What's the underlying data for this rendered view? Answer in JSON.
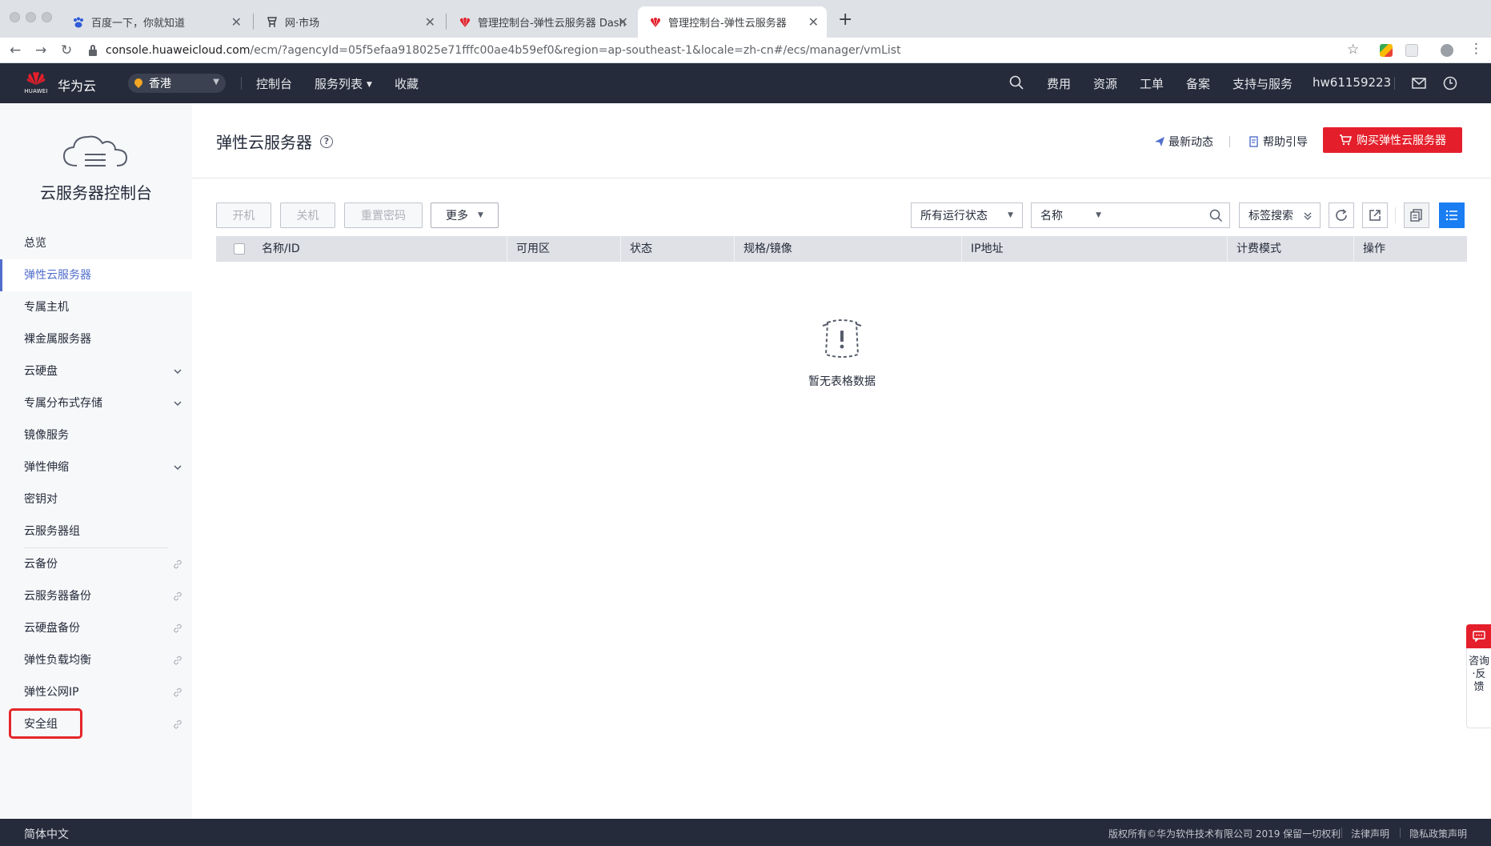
{
  "browser": {
    "tabs": [
      {
        "title": "百度一下，你就知道"
      },
      {
        "title": "网·市场"
      },
      {
        "title": "管理控制台-弹性云服务器 Dashboard"
      },
      {
        "title": "管理控制台-弹性云服务器"
      }
    ],
    "url_host": "console.huaweicloud.com",
    "url_rest": "/ecm/?agencyId=05f5efaa918025e71fffc00ae4b59ef0&region=ap-southeast-1&locale=zh-cn#/ecs/manager/vmList"
  },
  "header": {
    "logo_text": "HUAWEI",
    "brand": "华为云",
    "region": "香港",
    "nav": [
      "控制台",
      "服务列表",
      "收藏"
    ],
    "right_links": [
      "费用",
      "资源",
      "工单",
      "备案",
      "支持与服务"
    ],
    "username": "hw61159223"
  },
  "sidebar": {
    "title": "云服务器控制台",
    "items": [
      {
        "label": "总览"
      },
      {
        "label": "弹性云服务器",
        "active": true
      },
      {
        "label": "专属主机"
      },
      {
        "label": "裸金属服务器"
      },
      {
        "label": "云硬盘",
        "expandable": true
      },
      {
        "label": "专属分布式存储",
        "expandable": true
      },
      {
        "label": "镜像服务"
      },
      {
        "label": "弹性伸缩",
        "expandable": true
      },
      {
        "label": "密钥对"
      },
      {
        "label": "云服务器组"
      }
    ],
    "external_items": [
      {
        "label": "云备份"
      },
      {
        "label": "云服务器备份"
      },
      {
        "label": "云硬盘备份"
      },
      {
        "label": "弹性负载均衡"
      },
      {
        "label": "弹性公网IP"
      },
      {
        "label": "安全组",
        "highlighted": true
      }
    ]
  },
  "main": {
    "title": "弹性云服务器",
    "latest_news": "最新动态",
    "help_guide": "帮助引导",
    "buy_button": "购买弹性云服务器",
    "toolbar": {
      "start": "开机",
      "stop": "关机",
      "reset_password": "重置密码",
      "more": "更多",
      "status_filter": "所有运行状态",
      "search_field": "名称",
      "search_placeholder": "",
      "tag_search": "标签搜索"
    },
    "table": {
      "columns": [
        "名称/ID",
        "可用区",
        "状态",
        "规格/镜像",
        "IP地址",
        "计费模式",
        "操作"
      ],
      "rows": [],
      "empty_text": "暂无表格数据"
    }
  },
  "feedback": {
    "label": "咨询·反馈"
  },
  "footer": {
    "language": "简体中文",
    "copyright": "版权所有©华为软件技术有限公司 2019 保留一切权利",
    "legal": "法律声明",
    "privacy": "隐私政策声明"
  },
  "colors": {
    "header_bg": "#252b3a",
    "accent_blue": "#526ecc",
    "brand_red": "#e41f2b",
    "highlight_red": "#e4262a"
  }
}
